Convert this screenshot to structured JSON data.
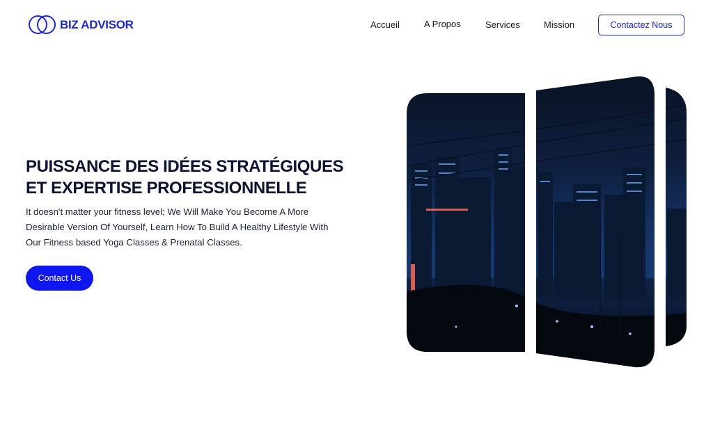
{
  "header": {
    "brand": "BIZ ADVISOR",
    "nav": [
      "Accueil",
      "A Propos",
      "Services",
      "Mission"
    ],
    "contact_button": "Contactez Nous"
  },
  "hero": {
    "title_lines": [
      "PUISSANCE DES IDÉES STRATÉGIQUES",
      "ET EXPERTISE PROFESSIONNELLE"
    ],
    "body_lines": [
      "It doesn't matter your fitness level; We Will Make You Become A More",
      "Desirable Version Of Yourself, Learn How To Build A Healthy Lifestyle With",
      "Our Fitness based Yoga Classes & Prenatal Classes."
    ],
    "button": "Contact Us",
    "image_alt": "night-city-skyline-panels"
  },
  "colors": {
    "accent": "#1a25e6",
    "button_bg": "#0f17f0",
    "title": "#0b1233"
  }
}
